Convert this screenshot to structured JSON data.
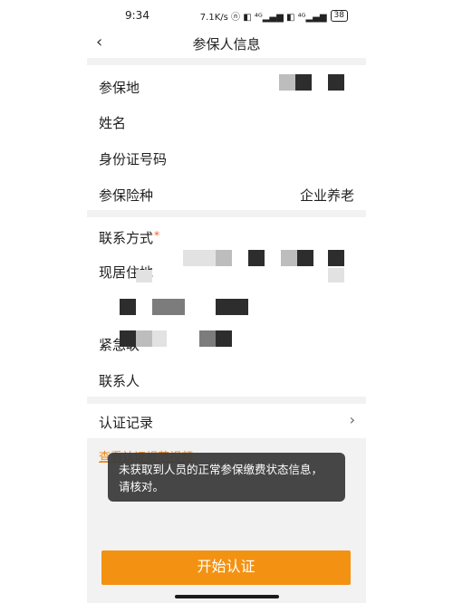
{
  "status_bar": {
    "time": "9:34",
    "right_text": "7.1K/s ⓝ ◧ ⁴ᴳ▂▄▆ ◧ ⁴ᴳ▂▄▆",
    "battery": "38"
  },
  "nav": {
    "back_icon": "chevron-left-icon",
    "title": "参保人信息"
  },
  "form": {
    "insured_place_label": "参保地",
    "name_label": "姓名",
    "id_number_label": "身份证号码",
    "insurance_type_label": "参保险种",
    "insurance_type_value": "企业养老",
    "contact_label": "联系方式",
    "required_mark": "*",
    "address_label": "现居住地",
    "emergency_label": "紧急联系人",
    "emergency_label_visible": "紧急联",
    "contact_person_label": "联系人",
    "contact_person_label_visible": "联系人"
  },
  "auth": {
    "record_label": "认证记录",
    "chevron_icon": "chevron-right-icon"
  },
  "link": {
    "text": "查看认证规范视频"
  },
  "toast": {
    "line1": "未获取到人员的正常参保缴费状态信息，",
    "line2": "请核对。"
  },
  "actions": {
    "start_label": "开始认证"
  },
  "colors": {
    "accent": "#f39212",
    "link": "#e88a1a",
    "required": "#ff5a1f",
    "toast_bg": "#3c3c3c"
  }
}
